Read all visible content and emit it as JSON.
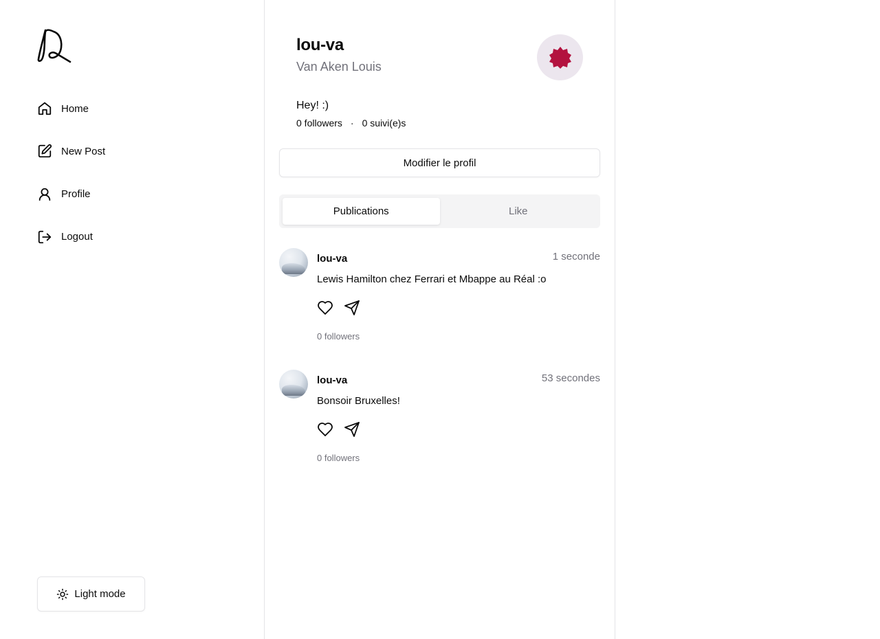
{
  "sidebar": {
    "logo_icon": "signature-logo-icon",
    "items": [
      {
        "label": "Home",
        "icon": "home-icon"
      },
      {
        "label": "New Post",
        "icon": "edit-icon"
      },
      {
        "label": "Profile",
        "icon": "user-icon"
      },
      {
        "label": "Logout",
        "icon": "logout-icon"
      }
    ],
    "mode_button": {
      "label": "Light mode",
      "icon": "sun-icon"
    }
  },
  "profile": {
    "username": "lou-va",
    "fullname": "Van Aken Louis",
    "avatar_color": "#b3123f",
    "bio": "Hey! :)",
    "followers": "0 followers",
    "separator": "·",
    "following": "0 suivi(e)s",
    "edit_button": "Modifier le profil"
  },
  "tabs": [
    {
      "label": "Publications",
      "active": true
    },
    {
      "label": "Like",
      "active": false
    }
  ],
  "posts": [
    {
      "user": "lou-va",
      "time": "1 seconde",
      "text": "Lewis Hamilton chez Ferrari et Mbappe au Réal :o",
      "count": "0 followers"
    },
    {
      "user": "lou-va",
      "time": "53 secondes",
      "text": "Bonsoir Bruxelles!",
      "count": "0 followers"
    }
  ]
}
